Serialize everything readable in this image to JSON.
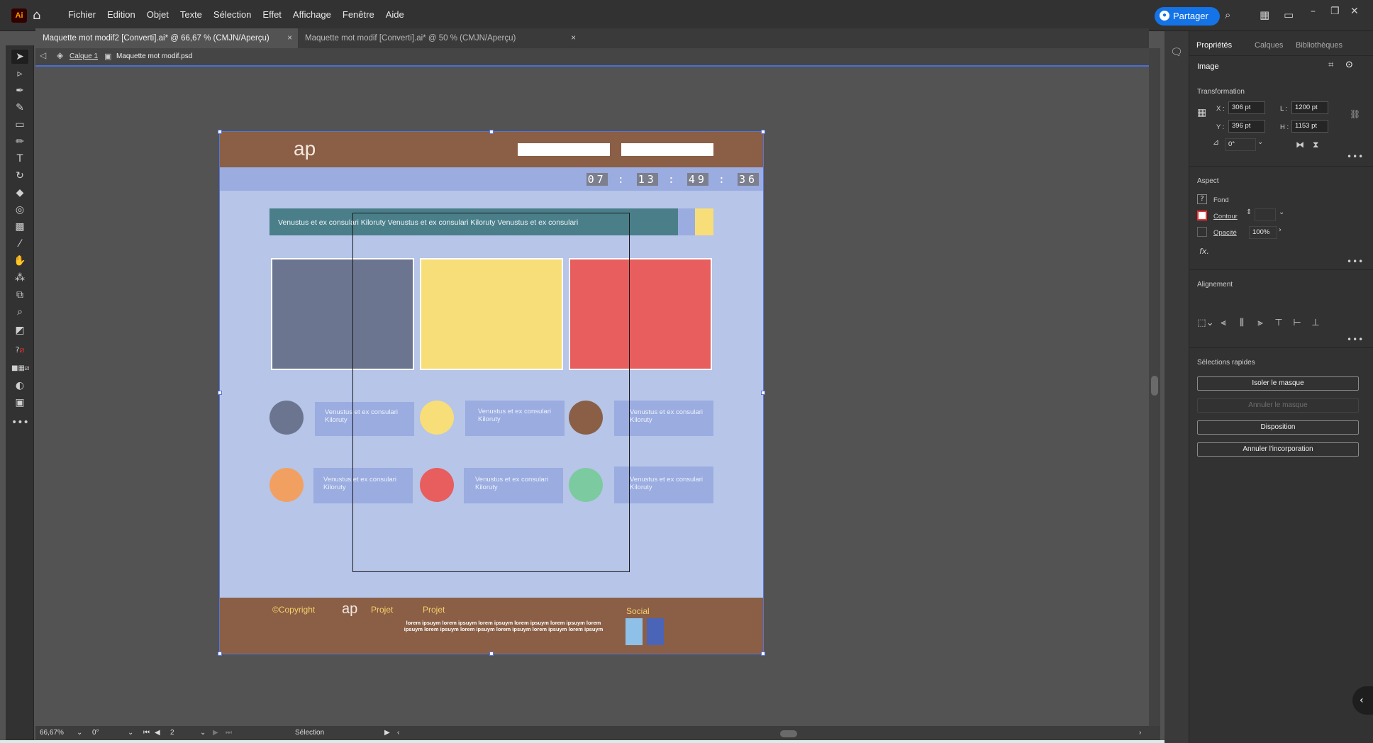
{
  "app": {
    "logo": "Ai",
    "menu": [
      "Fichier",
      "Edition",
      "Objet",
      "Texte",
      "Sélection",
      "Effet",
      "Affichage",
      "Fenêtre",
      "Aide"
    ],
    "share_label": "Partager"
  },
  "tabs": [
    {
      "label": "Maquette mot modif2 [Converti].ai* @ 66,67 % (CMJN/Aperçu)",
      "close": "×"
    },
    {
      "label": "Maquette mot modif [Converti].ai* @ 50 % (CMJN/Aperçu)",
      "close": "×"
    }
  ],
  "breadcrumb": {
    "layer": "Calque 1",
    "object": "Maquette mot modif.psd"
  },
  "design": {
    "header_logo": "ap",
    "timer": [
      "07",
      "13",
      "49",
      "36"
    ],
    "timer_sep": ":",
    "banner_text": "Venustus et ex consulari Kiloruty Venustus et ex consulari Kiloruty Venustus et ex consulari",
    "card_text": "Venustus et ex consulari Kiloruty",
    "footer": {
      "copyright": "©Copyright",
      "logo": "ap",
      "projet1": "Projet",
      "projet2": "Projet",
      "lorem": "lorem ipsuym lorem ipsuym lorem ipsuym lorem ipsuym lorem ipsuym lorem ipsuym lorem ipsuym lorem ipsuym lorem ipsuym lorem ipsuym lorem ipsuym",
      "social": "Social"
    },
    "colors": {
      "brown": "#8a5f46",
      "header_strip": "#9aace0",
      "body": "#b6c5e8",
      "teal": "#4a7f8a",
      "slate": "#6b7590",
      "yellow": "#f8de78",
      "red": "#e85d5d",
      "orange": "#f2a062",
      "green": "#7ccaa0"
    }
  },
  "status": {
    "zoom": "66,67%",
    "rotation": "0°",
    "artboard": "2",
    "tool": "Sélection"
  },
  "panel": {
    "tabs": [
      "Propriétés",
      "Calques",
      "Bibliothèques"
    ],
    "object_type": "Image",
    "transformation_title": "Transformation",
    "x_label": "X :",
    "x": "306 pt",
    "y_label": "Y :",
    "y": "396 pt",
    "w_label": "L :",
    "w": "1200 pt",
    "h_label": "H :",
    "h": "1153 pt",
    "angle": "0°",
    "aspect_title": "Aspect",
    "fill_label": "Fond",
    "stroke_label": "Contour",
    "opacity_label": "Opacité",
    "opacity": "100%",
    "fx": "fx.",
    "alignment_title": "Alignement",
    "quick_title": "Sélections rapides",
    "btn_isolate": "Isoler le masque",
    "btn_release": "Annuler le masque",
    "btn_arrange": "Disposition",
    "btn_unembed": "Annuler l'incorporation"
  }
}
